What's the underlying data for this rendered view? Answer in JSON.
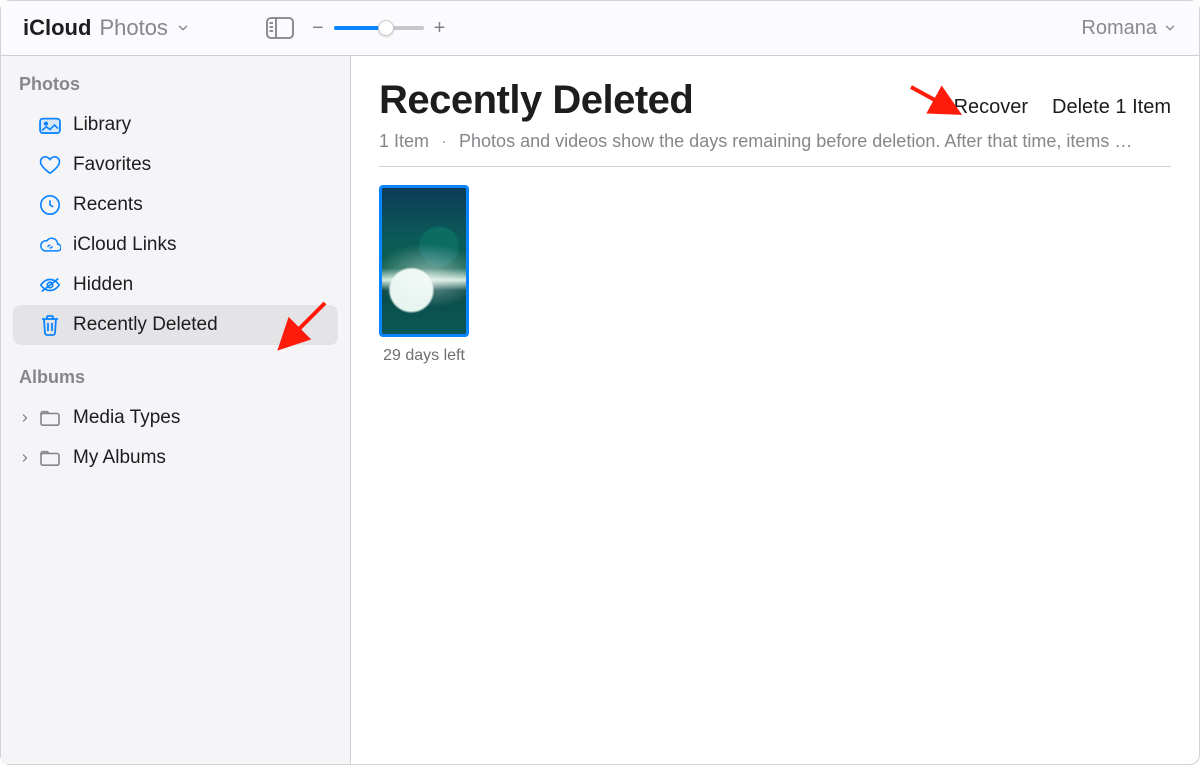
{
  "colors": {
    "accent": "#0a84ff"
  },
  "toolbar": {
    "app_name": "iCloud",
    "app_section": "Photos",
    "zoom_value": 0.58,
    "account_name": "Romana"
  },
  "sidebar": {
    "sections": [
      {
        "label": "Photos",
        "items": [
          {
            "icon": "photo-icon",
            "label": "Library",
            "selected": false
          },
          {
            "icon": "heart-icon",
            "label": "Favorites",
            "selected": false
          },
          {
            "icon": "clock-icon",
            "label": "Recents",
            "selected": false
          },
          {
            "icon": "cloud-link-icon",
            "label": "iCloud Links",
            "selected": false
          },
          {
            "icon": "hidden-eye-icon",
            "label": "Hidden",
            "selected": false
          },
          {
            "icon": "trash-icon",
            "label": "Recently Deleted",
            "selected": true
          }
        ]
      },
      {
        "label": "Albums",
        "items": [
          {
            "icon": "folder-icon",
            "label": "Media Types",
            "disclosure": true
          },
          {
            "icon": "folder-icon",
            "label": "My Albums",
            "disclosure": true
          }
        ]
      }
    ]
  },
  "content": {
    "title": "Recently Deleted",
    "actions": {
      "recover": "Recover",
      "delete": "Delete 1 Item"
    },
    "item_count_label": "1 Item",
    "info_text": "Photos and videos show the days remaining before deletion. After that time, items …",
    "items": [
      {
        "caption": "29 days left",
        "selected": true
      }
    ]
  }
}
